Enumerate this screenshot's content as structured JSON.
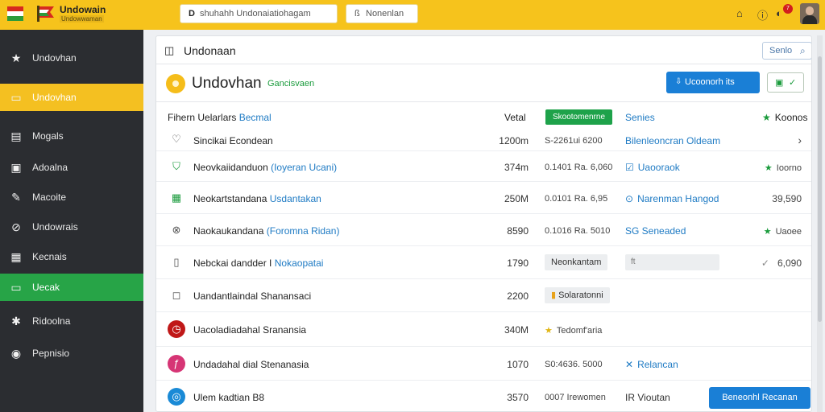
{
  "topbar": {
    "brand_title": "Undowain",
    "brand_sub": "Undowwaman",
    "search_icon": "D",
    "search_text": "shuhahh  Undonaiatiohagam",
    "second_icon": "ß",
    "second_text": "Nonenlan",
    "icons": [
      "home-icon",
      "info-icon",
      "notification-icon"
    ],
    "notif_count": "7",
    "colors": {
      "bar": "#f6c31c"
    }
  },
  "sidebar": {
    "items": [
      {
        "label": "Undovhan",
        "icon": "star-icon"
      },
      {
        "label": "Undovhan",
        "icon": "folder-icon"
      },
      {
        "label": "Mogals",
        "icon": "window-icon"
      },
      {
        "label": "Adoalna",
        "icon": "frame-icon"
      },
      {
        "label": "Macoite",
        "icon": "edit-icon"
      },
      {
        "label": "Undowrais",
        "icon": "link-icon"
      },
      {
        "label": "Kecnais",
        "icon": "grid-icon"
      },
      {
        "label": "Uecak",
        "icon": "folder-icon"
      },
      {
        "label": "Ridoolna",
        "icon": "gear-icon"
      },
      {
        "label": "Pepnisio",
        "icon": "palette-icon"
      }
    ],
    "active_yellow_index": 1,
    "active_green_index": 7
  },
  "panel": {
    "title": "Undonaan",
    "search_label": "Senlo",
    "heading": "Undovhan",
    "heading_tag": "Gancisvaen",
    "primary_button": "Ucoonorh its",
    "split_button_icon": "list-icon"
  },
  "table": {
    "header": {
      "file": "Fihern Uelarlars",
      "file_link": "Becmal",
      "volume": "Vetal",
      "badge": "Skootomenrne",
      "series": "Senies",
      "right": "Koonos"
    },
    "rows": [
      {
        "icon": "heart-icon",
        "name": "Sincikai Econdean",
        "link": "",
        "size": "1200m",
        "detail": "S-2261ui 6200",
        "label": "Bilenleoncran Oldeam",
        "right": "›"
      },
      {
        "icon": "shield-icon",
        "name": "Neovkaiidanduon",
        "link": "(Ioyeran Ucani)",
        "size": "374m",
        "detail": "0.1401 Ra. 6,060",
        "label": "Uaooraok",
        "right": "Ioorno"
      },
      {
        "icon": "table-icon",
        "name": "Neokartstandana",
        "link": "Usdantakan",
        "size": "250M",
        "detail": "0.0101 Ra. 6,95",
        "label": "Narenman Hangod",
        "right": "39,590"
      },
      {
        "icon": "globe-icon",
        "name": "Naokaukandana",
        "link": "(Foromna Ridan)",
        "size": "8590",
        "detail": "0.1016 Ra. 5010",
        "label": "SG Seneaded",
        "right": "Uaoee"
      },
      {
        "icon": "phone-icon",
        "name": "Nebckai dandder I",
        "link": "Nokaopatai",
        "size": "1790",
        "pill": "Neonkantam",
        "field": "ft",
        "right": "6,090"
      },
      {
        "icon": "tablet-icon",
        "name": "Uandantlaindal Shanansaci",
        "link": "",
        "size": "2200",
        "pill": "Solaratonni"
      },
      {
        "icon": "clock-icon",
        "name": "Uacoladiadahal Sranansia",
        "link": "",
        "size": "340M",
        "detail": "Tedomf'aria",
        "label": "",
        "right": ""
      },
      {
        "icon": "flower-icon",
        "name": "Undadahal dial Stenanasia",
        "link": "",
        "size": "1070",
        "detail": "S0:4636. 5000",
        "label": "Relancan",
        "right": ""
      },
      {
        "icon": "camera-icon",
        "name": "Ulem kadtian",
        "link": "B8",
        "size": "3570",
        "detail": "0007 Irewomen",
        "label": "IR Vioutan",
        "button": "Beneonhl Recanan"
      }
    ]
  }
}
